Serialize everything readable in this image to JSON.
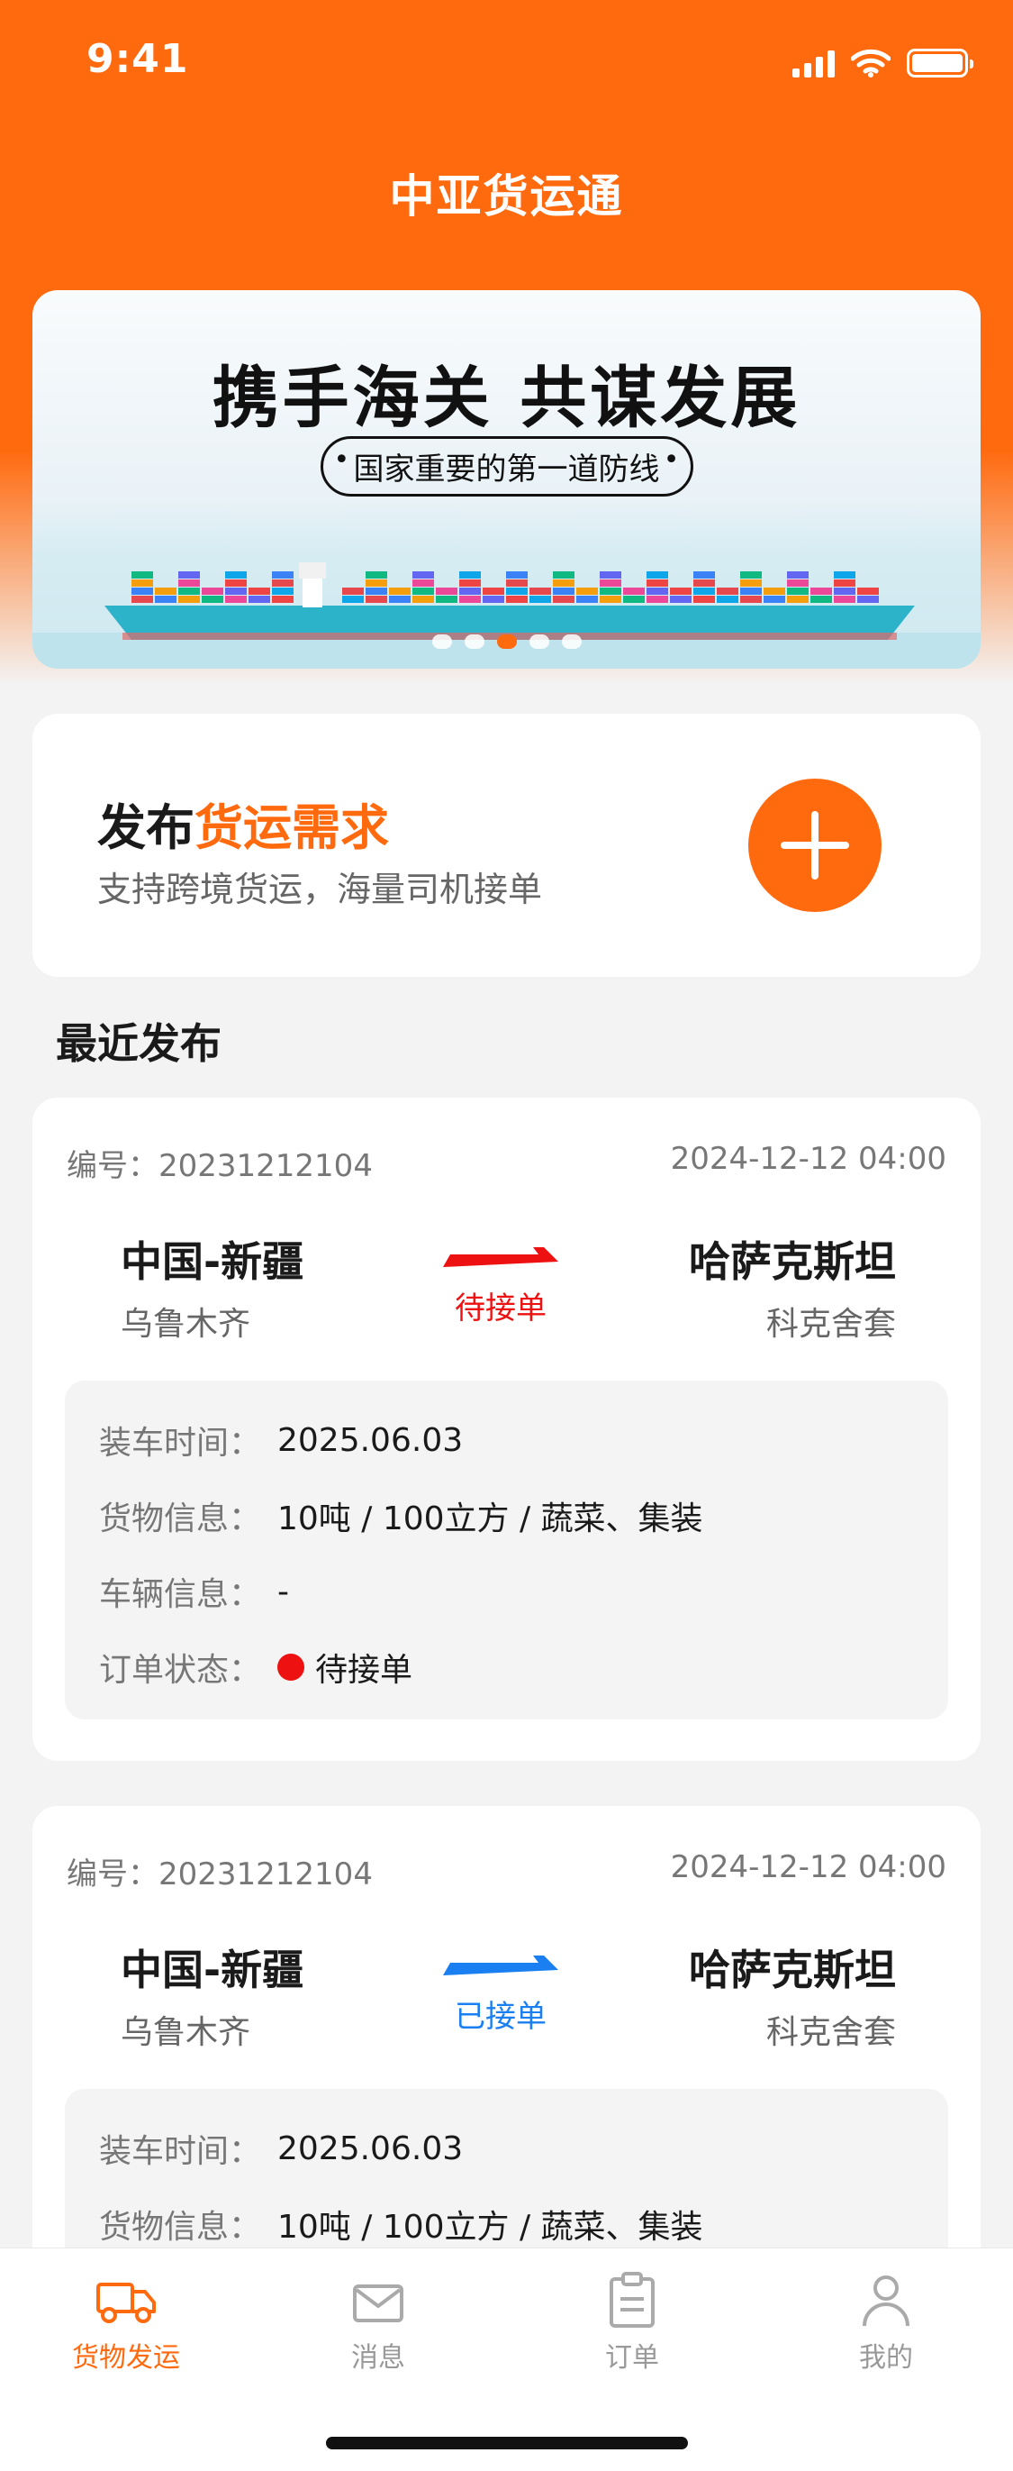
{
  "status_bar": {
    "time": "9:41"
  },
  "header": {
    "title": "中亚货运通"
  },
  "banner": {
    "headline": "携手海关  共谋发展",
    "subline": "国家重要的第一道防线",
    "carousel_active_index": 2,
    "carousel_count": 5
  },
  "publish": {
    "title_prefix": "发布",
    "title_accent": "货运需求",
    "description": "支持跨境货运，海量司机接单"
  },
  "recent": {
    "title": "最近发布"
  },
  "orders": [
    {
      "number": "编号：20231212104",
      "time": "2024-12-12 04:00",
      "from_city": "中国-新疆",
      "from_sub": "乌鲁木齐",
      "to_city": "哈萨克斯坦",
      "to_sub": "科克舍套",
      "status": "待接单",
      "status_color": "#ee1111",
      "details": [
        {
          "label": "装车时间：",
          "value": "2025.06.03"
        },
        {
          "label": "货物信息：",
          "value": "10吨 / 100立方 / 蔬菜、集装"
        },
        {
          "label": "车辆信息：",
          "value": "-"
        },
        {
          "label": "订单状态：",
          "value": "待接单"
        }
      ]
    },
    {
      "number": "编号：20231212104",
      "time": "2024-12-12 04:00",
      "from_city": "中国-新疆",
      "from_sub": "乌鲁木齐",
      "to_city": "哈萨克斯坦",
      "to_sub": "科克舍套",
      "status": "已接单",
      "status_color": "#1a7ff0",
      "details": [
        {
          "label": "装车时间：",
          "value": "2025.06.03"
        },
        {
          "label": "货物信息：",
          "value": "10吨 / 100立方 / 蔬菜、集装"
        }
      ]
    }
  ],
  "tab_bar": {
    "items": [
      {
        "label": "货物发运",
        "icon": "truck-icon",
        "active": true
      },
      {
        "label": "消息",
        "icon": "mail-icon",
        "active": false
      },
      {
        "label": "订单",
        "icon": "clipboard-icon",
        "active": false
      },
      {
        "label": "我的",
        "icon": "user-icon",
        "active": false
      }
    ]
  },
  "colors": {
    "brand": "#ff6a0f",
    "pending": "#ee1111",
    "accepted": "#1a7ff0"
  }
}
